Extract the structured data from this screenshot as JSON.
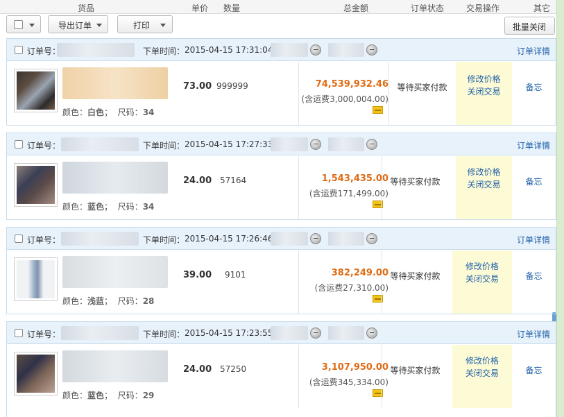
{
  "columns": {
    "goods": "货品",
    "unit_price": "单价",
    "quantity": "数量",
    "total": "总金额",
    "status": "订单状态",
    "action": "交易操作",
    "other": "其它"
  },
  "toolbar": {
    "export_label": "导出订单",
    "print_label": "打印",
    "batch_close_label": "批量关闭"
  },
  "labels": {
    "order_no": "订单号：",
    "order_time": "下单时间：",
    "order_detail": "订单详情",
    "modify_price": "修改价格",
    "close_trade": "关闭交易",
    "remark": "备忘"
  },
  "orders": [
    {
      "time": "2015-04-15 17:31:04",
      "price": "73.00",
      "qty": "999999",
      "total": "74,539,932.46",
      "shipping": "(含运费3,000,004.00)",
      "status": "等待买家付款",
      "spec_color_key": "颜色：",
      "spec_color": "白色",
      "spec_size_key": "尺码：",
      "spec_size": "34"
    },
    {
      "time": "2015-04-15 17:27:33",
      "price": "24.00",
      "qty": "57164",
      "total": "1,543,435.00",
      "shipping": "(含运费171,499.00)",
      "status": "等待买家付款",
      "spec_color_key": "颜色：",
      "spec_color": "蓝色",
      "spec_size_key": "尺码：",
      "spec_size": "34"
    },
    {
      "time": "2015-04-15 17:26:46",
      "price": "39.00",
      "qty": "9101",
      "total": "382,249.00",
      "shipping": "(含运费27,310.00)",
      "status": "等待买家付款",
      "spec_color_key": "颜色：",
      "spec_color": "浅蓝",
      "spec_size_key": "尺码：",
      "spec_size": "28"
    },
    {
      "time": "2015-04-15 17:23:55",
      "price": "24.00",
      "qty": "57250",
      "total": "3,107,950.00",
      "shipping": "(含运费345,334.00)",
      "status": "等待买家付款",
      "spec_color_key": "颜色：",
      "spec_color": "蓝色",
      "spec_size_key": "尺码：",
      "spec_size": "29"
    }
  ],
  "colors": {
    "link": "#1e5fa8",
    "total_amount": "#e06b14",
    "order_header_bg": "#e8f2fb",
    "ops_bg": "#fdfbd6"
  }
}
